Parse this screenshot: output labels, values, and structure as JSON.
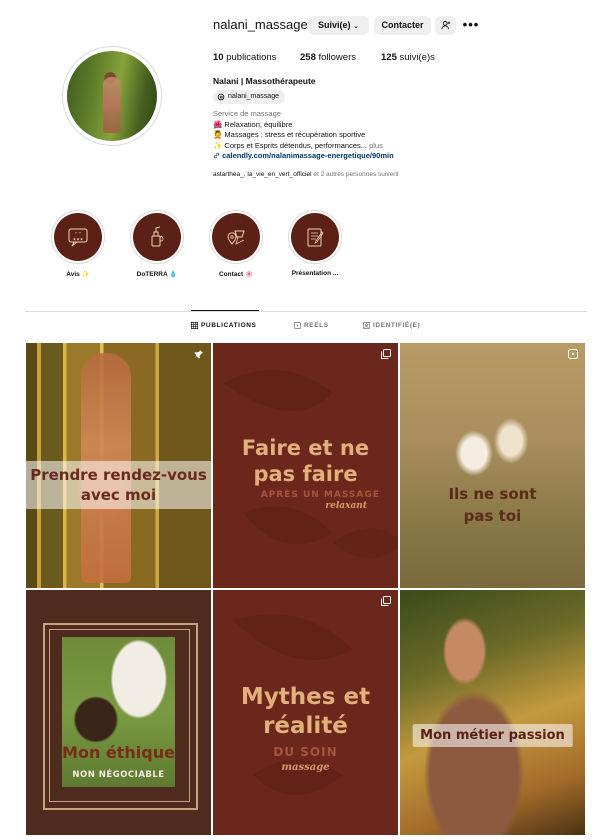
{
  "profile": {
    "username": "nalani_massage",
    "follow_button": "Suivi(e)",
    "contact_button": "Contacter",
    "more": "•••",
    "stats": {
      "posts": "10",
      "posts_label": "publications",
      "followers": "258",
      "followers_label": "followers",
      "following": "125",
      "following_label": "suivi(e)s"
    },
    "full_name": "Nalani | Massothérapeute",
    "threads_handle": "nalani_massage",
    "category": "Service de massage",
    "bio_lines": [
      "🌺 Relaxation, équilibre",
      "💆 Massages : stress et récupération sportive",
      "✨ Corps et Esprits détendus, performances..."
    ],
    "bio_more": "plus",
    "link": "calendly.com/nalanimassage-energetique/90min",
    "followed_by_names": "astarthea_, la_vie_en_vert_officiel",
    "followed_by_suffix": "et 2 autres personnes suivent"
  },
  "highlights": [
    {
      "label": "Avis ✨",
      "icon": "reviews-icon"
    },
    {
      "label": "DoTERRA 💧",
      "icon": "oil-bottle-icon"
    },
    {
      "label": "Contact 🌸",
      "icon": "location-icon"
    },
    {
      "label": "Présentation ...",
      "icon": "notebook-icon"
    }
  ],
  "tabs": [
    {
      "label": "PUBLICATIONS",
      "icon": "grid-icon",
      "active": true
    },
    {
      "label": "REELS",
      "icon": "reels-icon",
      "active": false
    },
    {
      "label": "IDENTIFIÉ(E)",
      "icon": "tagged-icon",
      "active": false
    }
  ],
  "posts": [
    {
      "title": "Prendre rendez-vous\navec moi",
      "badge": "pinned-icon"
    },
    {
      "title": "Faire et ne\npas faire",
      "subtitle": "APRÈS UN MASSAGE",
      "script": "relaxant",
      "badge": "carousel-icon"
    },
    {
      "title": "Ils ne sont\npas toi",
      "badge": "reel-icon"
    },
    {
      "title": "Mon éthique",
      "subtitle": "NON NÉGOCIABLE"
    },
    {
      "title": "Mythes et\nréalité",
      "subtitle": "DU SOIN",
      "script": "massage",
      "badge": "carousel-icon"
    },
    {
      "title": "Mon métier passion"
    }
  ],
  "colors": {
    "brand_brown": "#6b271c",
    "highlight_brown": "#5c2116",
    "tan_text": "#e3b07c",
    "link_blue": "#00376b"
  }
}
